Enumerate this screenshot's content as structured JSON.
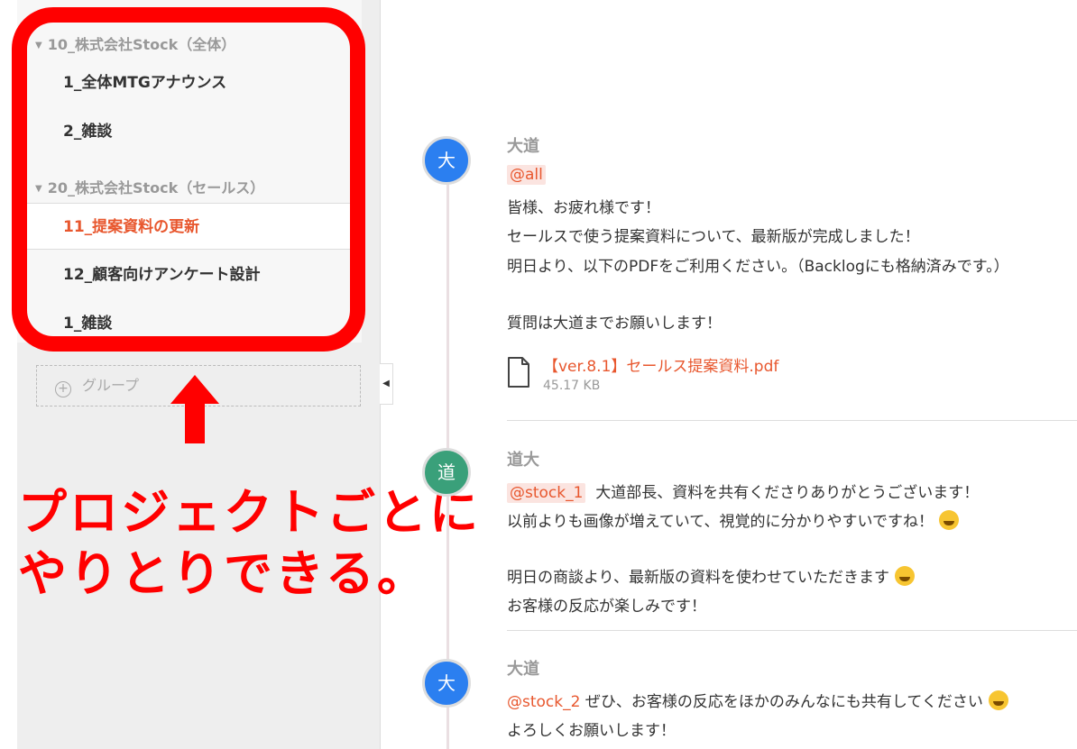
{
  "sidebar": {
    "groups": [
      {
        "name": "10_株式会社Stock（全体）",
        "channels": [
          "1_全体MTGアナウンス",
          "2_雑談"
        ]
      },
      {
        "name": "20_株式会社Stock（セールス）",
        "channels": [
          "11_提案資料の更新",
          "12_顧客向けアンケート設計",
          "1_雑談"
        ]
      }
    ],
    "active_channel": "11_提案資料の更新",
    "add_group_label": "グループ"
  },
  "annotation": {
    "line1": "プロジェクトごとに",
    "line2": "やりとりできる。",
    "color": "#ff0000"
  },
  "messages": [
    {
      "avatar": "大",
      "avatar_color": "#2b7ff0",
      "author": "大道",
      "mention": "@all",
      "lines": [
        "皆様、お疲れ様です！",
        "セールスで使う提案資料について、最新版が完成しました！",
        "明日より、以下のPDFをご利用ください。（Backlogにも格納済みです。）",
        "質問は大道までお願いします！"
      ],
      "attachment": {
        "name": "【ver.8.1】セールス提案資料.pdf",
        "size": "45.17 KB"
      }
    },
    {
      "avatar": "道",
      "avatar_color": "#3aa07a",
      "author": "道大",
      "mention": "@stock_1",
      "lines": [
        "大道部長、資料を共有くださりありがとうございます！",
        "以前よりも画像が増えていて、視覚的に分かりやすいですね！",
        "明日の商談より、最新版の資料を使わせていただきます",
        "お客様の反応が楽しみです！"
      ]
    },
    {
      "avatar": "大",
      "avatar_color": "#2b7ff0",
      "author": "大道",
      "mention": "@stock_2",
      "lines": [
        "ぜひ、お客様の反応をほかのみんなにも共有してください",
        "よろしくお願いします！"
      ]
    }
  ],
  "colors": {
    "accent": "#e8572e",
    "sidebar_bg": "#eeeeee"
  }
}
